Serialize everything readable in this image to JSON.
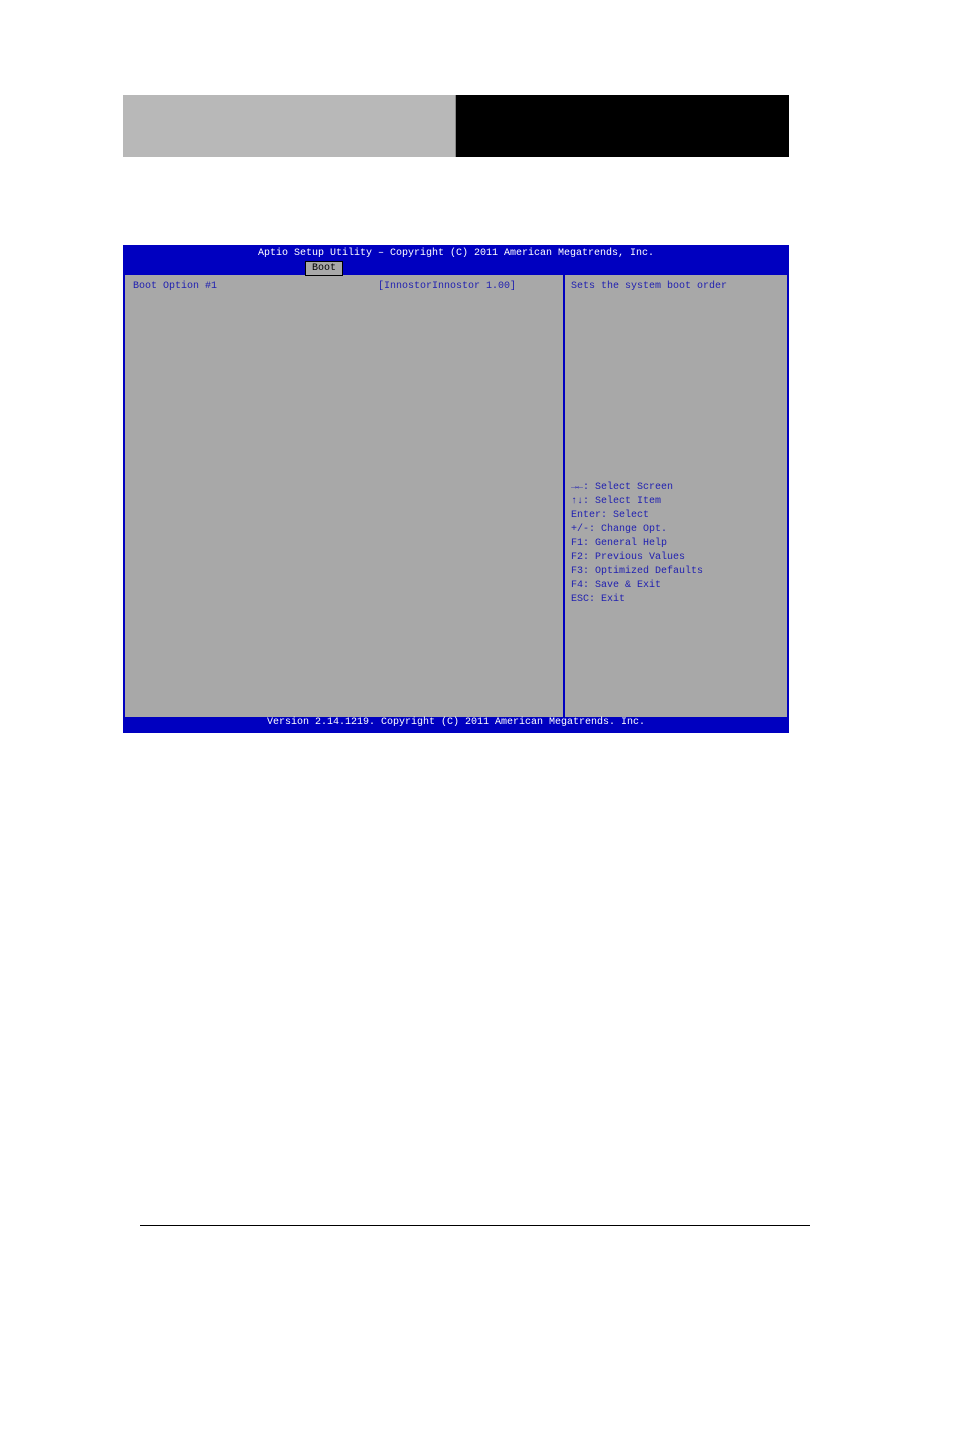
{
  "bios": {
    "title_top": "Aptio Setup Utility – Copyright (C) 2011 American Megatrends, Inc.",
    "tab_active": "Boot",
    "main": {
      "row1_label": "Boot Option #1",
      "row1_value": "[InnostorInnostor 1.00]"
    },
    "help": {
      "description": "Sets the system boot order",
      "keys": {
        "k1": "→←: Select Screen",
        "k2": "↑↓: Select Item",
        "k3": "Enter: Select",
        "k4": "+/-: Change Opt.",
        "k5": "F1: General Help",
        "k6": "F2: Previous Values",
        "k7": "F3: Optimized Defaults",
        "k8": "F4: Save & Exit",
        "k9": "ESC: Exit"
      }
    },
    "footer": "Version 2.14.1219. Copyright (C) 2011 American Megatrends. Inc."
  }
}
